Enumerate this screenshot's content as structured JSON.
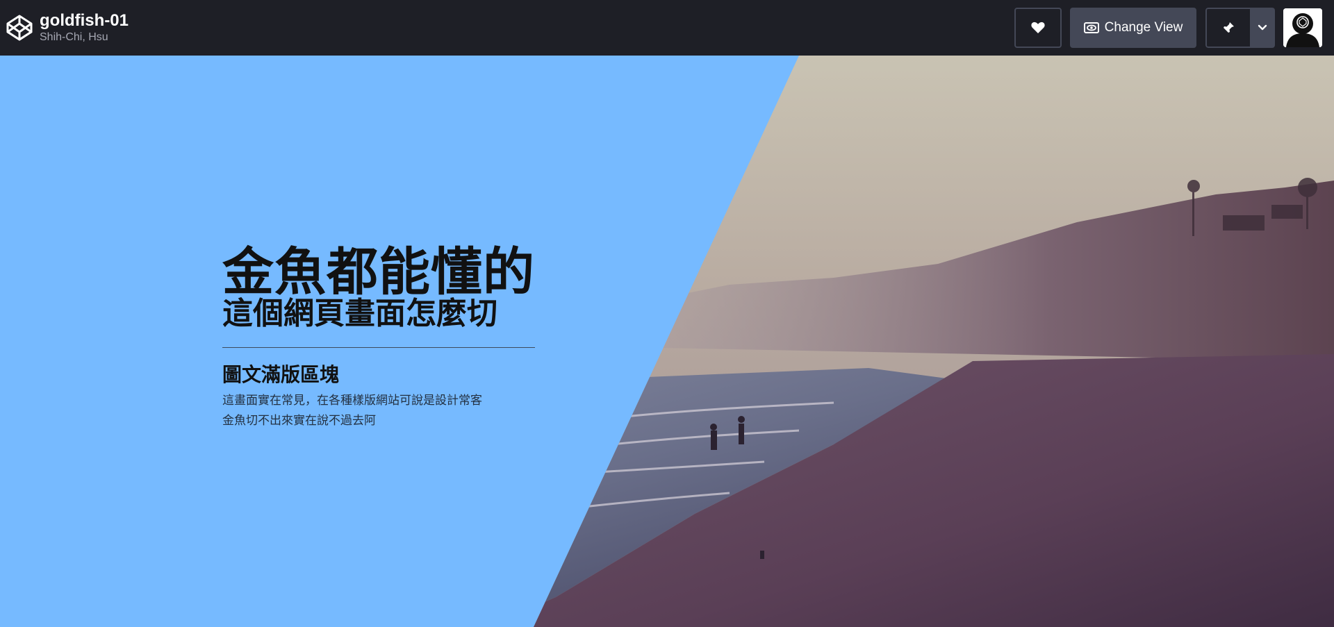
{
  "header": {
    "pen_title": "goldfish-01",
    "author": "Shih-Chi, Hsu",
    "logo_icon": "codepen-logo-icon",
    "heart_icon": "heart-icon",
    "change_view_label": "Change View",
    "change_view_icon": "eye-view-icon",
    "pin_icon": "pin-icon",
    "pin_menu_icon": "chevron-down-icon",
    "avatar_icon": "user-avatar"
  },
  "hero": {
    "headline": "金魚都能懂的",
    "subheadline": "這個網頁畫面怎麼切",
    "section_title": "圖文滿版區塊",
    "description_line1": "這畫面實在常見，在各種樣版網站可說是設計常客",
    "description_line2": "金魚切不出來實在說不過去阿",
    "photo": "beach-photo",
    "colors": {
      "panel": "#76baff",
      "header_bg": "#1e1f26",
      "button_bg": "#444857"
    }
  }
}
